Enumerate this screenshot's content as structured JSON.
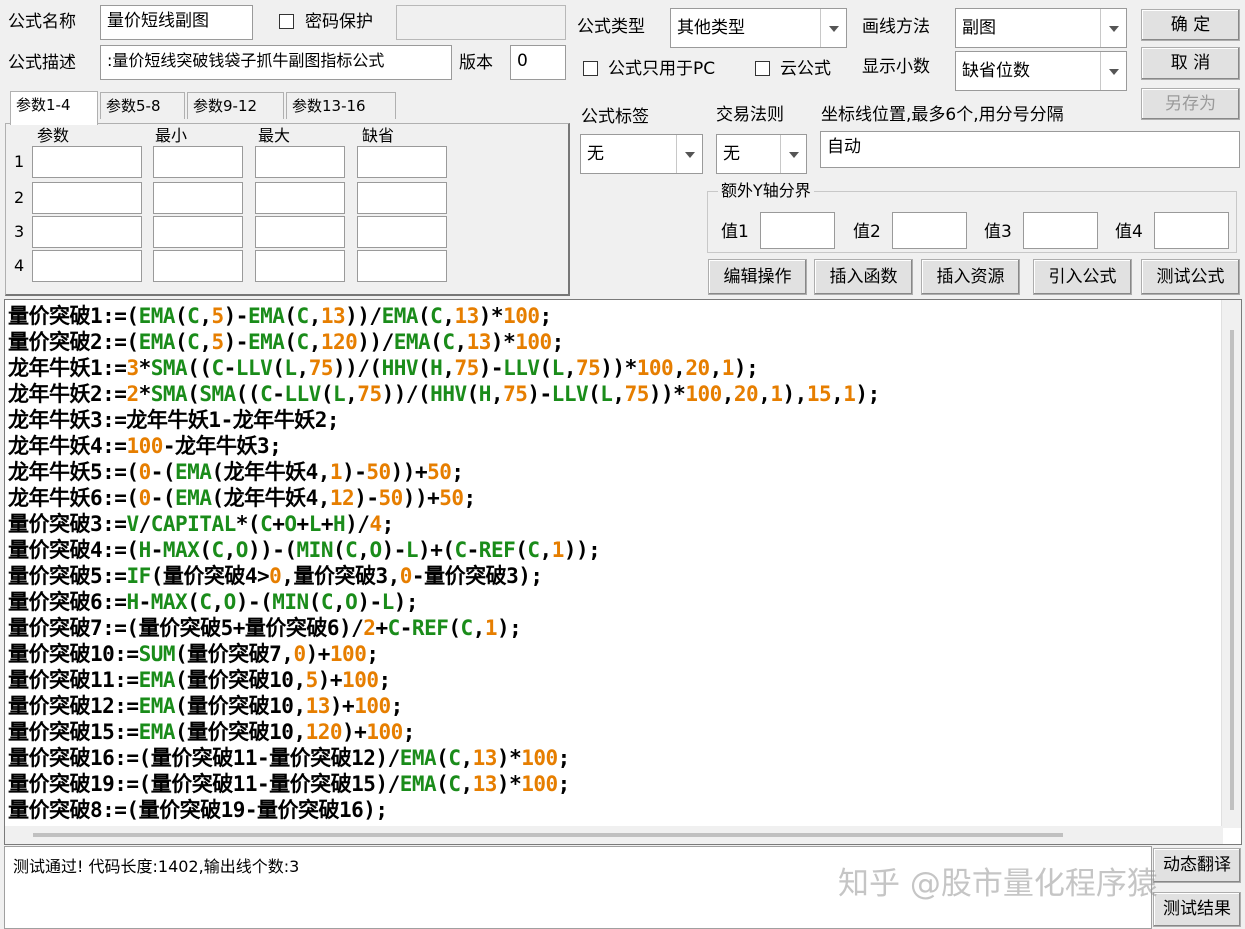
{
  "header": {
    "name_label": "公式名称",
    "name_value": "量价短线副图",
    "password_label": "密码保护",
    "desc_label": "公式描述",
    "desc_value": "量价短线突破钱袋子抓牛副图指标公式:",
    "version_label": "版本",
    "version_value": "0",
    "type_label": "公式类型",
    "type_value": "其他类型",
    "draw_label": "画线方法",
    "draw_value": "副图",
    "pc_only_label": "公式只用于PC",
    "cloud_label": "云公式",
    "decimals_label": "显示小数",
    "decimals_value": "缺省位数",
    "tag_label": "公式标签",
    "tag_value": "无",
    "rule_label": "交易法则",
    "rule_value": "无",
    "coord_label": "坐标线位置,最多6个,用分号分隔",
    "coord_value": "自动",
    "extra_y_label": "额外Y轴分界",
    "val1_label": "值1",
    "val2_label": "值2",
    "val3_label": "值3",
    "val4_label": "值4"
  },
  "buttons": {
    "ok": "确  定",
    "cancel": "取  消",
    "save_as": "另存为",
    "edit_ops": "编辑操作",
    "insert_func": "插入函数",
    "insert_res": "插入资源",
    "import_formula": "引入公式",
    "test_formula": "测试公式",
    "translate": "动态翻译",
    "test_result": "测试结果"
  },
  "params": {
    "tabs": [
      "参数1-4",
      "参数5-8",
      "参数9-12",
      "参数13-16"
    ],
    "columns": [
      "参数",
      "最小",
      "最大",
      "缺省"
    ],
    "rows": [
      "1",
      "2",
      "3",
      "4"
    ]
  },
  "code": {
    "lines": [
      [
        [
          "量价突破1:=(",
          "t"
        ],
        [
          "EMA",
          "f"
        ],
        [
          "(",
          "t"
        ],
        [
          "C",
          "f"
        ],
        [
          ",",
          "t"
        ],
        [
          "5",
          "n"
        ],
        [
          ")-",
          "t"
        ],
        [
          "EMA",
          "f"
        ],
        [
          "(",
          "t"
        ],
        [
          "C",
          "f"
        ],
        [
          ",",
          "t"
        ],
        [
          "13",
          "n"
        ],
        [
          "))/",
          "t"
        ],
        [
          "EMA",
          "f"
        ],
        [
          "(",
          "t"
        ],
        [
          "C",
          "f"
        ],
        [
          ",",
          "t"
        ],
        [
          "13",
          "n"
        ],
        [
          ")*",
          "t"
        ],
        [
          "100",
          "n"
        ],
        [
          ";",
          "t"
        ]
      ],
      [
        [
          "量价突破2:=(",
          "t"
        ],
        [
          "EMA",
          "f"
        ],
        [
          "(",
          "t"
        ],
        [
          "C",
          "f"
        ],
        [
          ",",
          "t"
        ],
        [
          "5",
          "n"
        ],
        [
          ")-",
          "t"
        ],
        [
          "EMA",
          "f"
        ],
        [
          "(",
          "t"
        ],
        [
          "C",
          "f"
        ],
        [
          ",",
          "t"
        ],
        [
          "120",
          "n"
        ],
        [
          "))/",
          "t"
        ],
        [
          "EMA",
          "f"
        ],
        [
          "(",
          "t"
        ],
        [
          "C",
          "f"
        ],
        [
          ",",
          "t"
        ],
        [
          "13",
          "n"
        ],
        [
          ")*",
          "t"
        ],
        [
          "100",
          "n"
        ],
        [
          ";",
          "t"
        ]
      ],
      [
        [
          "龙年牛妖1:=",
          "t"
        ],
        [
          "3",
          "n"
        ],
        [
          "*",
          "t"
        ],
        [
          "SMA",
          "f"
        ],
        [
          "((",
          "t"
        ],
        [
          "C",
          "f"
        ],
        [
          "-",
          "t"
        ],
        [
          "LLV",
          "f"
        ],
        [
          "(",
          "t"
        ],
        [
          "L",
          "f"
        ],
        [
          ",",
          "t"
        ],
        [
          "75",
          "n"
        ],
        [
          "))/(",
          "t"
        ],
        [
          "HHV",
          "f"
        ],
        [
          "(",
          "t"
        ],
        [
          "H",
          "f"
        ],
        [
          ",",
          "t"
        ],
        [
          "75",
          "n"
        ],
        [
          ")-",
          "t"
        ],
        [
          "LLV",
          "f"
        ],
        [
          "(",
          "t"
        ],
        [
          "L",
          "f"
        ],
        [
          ",",
          "t"
        ],
        [
          "75",
          "n"
        ],
        [
          "))*",
          "t"
        ],
        [
          "100",
          "n"
        ],
        [
          ",",
          "t"
        ],
        [
          "20",
          "n"
        ],
        [
          ",",
          "t"
        ],
        [
          "1",
          "n"
        ],
        [
          ");",
          "t"
        ]
      ],
      [
        [
          "龙年牛妖2:=",
          "t"
        ],
        [
          "2",
          "n"
        ],
        [
          "*",
          "t"
        ],
        [
          "SMA",
          "f"
        ],
        [
          "(",
          "t"
        ],
        [
          "SMA",
          "f"
        ],
        [
          "((",
          "t"
        ],
        [
          "C",
          "f"
        ],
        [
          "-",
          "t"
        ],
        [
          "LLV",
          "f"
        ],
        [
          "(",
          "t"
        ],
        [
          "L",
          "f"
        ],
        [
          ",",
          "t"
        ],
        [
          "75",
          "n"
        ],
        [
          "))/(",
          "t"
        ],
        [
          "HHV",
          "f"
        ],
        [
          "(",
          "t"
        ],
        [
          "H",
          "f"
        ],
        [
          ",",
          "t"
        ],
        [
          "75",
          "n"
        ],
        [
          ")-",
          "t"
        ],
        [
          "LLV",
          "f"
        ],
        [
          "(",
          "t"
        ],
        [
          "L",
          "f"
        ],
        [
          ",",
          "t"
        ],
        [
          "75",
          "n"
        ],
        [
          "))*",
          "t"
        ],
        [
          "100",
          "n"
        ],
        [
          ",",
          "t"
        ],
        [
          "20",
          "n"
        ],
        [
          ",",
          "t"
        ],
        [
          "1",
          "n"
        ],
        [
          "),",
          "t"
        ],
        [
          "15",
          "n"
        ],
        [
          ",",
          "t"
        ],
        [
          "1",
          "n"
        ],
        [
          ");",
          "t"
        ]
      ],
      [
        [
          "龙年牛妖3:=龙年牛妖1-龙年牛妖2;",
          "t"
        ]
      ],
      [
        [
          "龙年牛妖4:=",
          "t"
        ],
        [
          "100",
          "n"
        ],
        [
          "-龙年牛妖3;",
          "t"
        ]
      ],
      [
        [
          "龙年牛妖5:=(",
          "t"
        ],
        [
          "0",
          "n"
        ],
        [
          "-(",
          "t"
        ],
        [
          "EMA",
          "f"
        ],
        [
          "(龙年牛妖4,",
          "t"
        ],
        [
          "1",
          "n"
        ],
        [
          ")-",
          "t"
        ],
        [
          "50",
          "n"
        ],
        [
          "))+",
          "t"
        ],
        [
          "50",
          "n"
        ],
        [
          ";",
          "t"
        ]
      ],
      [
        [
          "龙年牛妖6:=(",
          "t"
        ],
        [
          "0",
          "n"
        ],
        [
          "-(",
          "t"
        ],
        [
          "EMA",
          "f"
        ],
        [
          "(龙年牛妖4,",
          "t"
        ],
        [
          "12",
          "n"
        ],
        [
          ")-",
          "t"
        ],
        [
          "50",
          "n"
        ],
        [
          "))+",
          "t"
        ],
        [
          "50",
          "n"
        ],
        [
          ";",
          "t"
        ]
      ],
      [
        [
          "量价突破3:=",
          "t"
        ],
        [
          "V",
          "f"
        ],
        [
          "/",
          "t"
        ],
        [
          "CAPITAL",
          "f"
        ],
        [
          "*(",
          "t"
        ],
        [
          "C",
          "f"
        ],
        [
          "+",
          "t"
        ],
        [
          "O",
          "f"
        ],
        [
          "+",
          "t"
        ],
        [
          "L",
          "f"
        ],
        [
          "+",
          "t"
        ],
        [
          "H",
          "f"
        ],
        [
          ")/",
          "t"
        ],
        [
          "4",
          "n"
        ],
        [
          ";",
          "t"
        ]
      ],
      [
        [
          "量价突破4:=(",
          "t"
        ],
        [
          "H",
          "f"
        ],
        [
          "-",
          "t"
        ],
        [
          "MAX",
          "f"
        ],
        [
          "(",
          "t"
        ],
        [
          "C",
          "f"
        ],
        [
          ",",
          "t"
        ],
        [
          "O",
          "f"
        ],
        [
          "))-(",
          "t"
        ],
        [
          "MIN",
          "f"
        ],
        [
          "(",
          "t"
        ],
        [
          "C",
          "f"
        ],
        [
          ",",
          "t"
        ],
        [
          "O",
          "f"
        ],
        [
          ")-",
          "t"
        ],
        [
          "L",
          "f"
        ],
        [
          ")+(",
          "t"
        ],
        [
          "C",
          "f"
        ],
        [
          "-",
          "t"
        ],
        [
          "REF",
          "f"
        ],
        [
          "(",
          "t"
        ],
        [
          "C",
          "f"
        ],
        [
          ",",
          "t"
        ],
        [
          "1",
          "n"
        ],
        [
          "));",
          "t"
        ]
      ],
      [
        [
          "量价突破5:=",
          "t"
        ],
        [
          "IF",
          "f"
        ],
        [
          "(量价突破4>",
          "t"
        ],
        [
          "0",
          "n"
        ],
        [
          ",量价突破3,",
          "t"
        ],
        [
          "0",
          "n"
        ],
        [
          "-量价突破3);",
          "t"
        ]
      ],
      [
        [
          "量价突破6:=",
          "t"
        ],
        [
          "H",
          "f"
        ],
        [
          "-",
          "t"
        ],
        [
          "MAX",
          "f"
        ],
        [
          "(",
          "t"
        ],
        [
          "C",
          "f"
        ],
        [
          ",",
          "t"
        ],
        [
          "O",
          "f"
        ],
        [
          ")-(",
          "t"
        ],
        [
          "MIN",
          "f"
        ],
        [
          "(",
          "t"
        ],
        [
          "C",
          "f"
        ],
        [
          ",",
          "t"
        ],
        [
          "O",
          "f"
        ],
        [
          ")-",
          "t"
        ],
        [
          "L",
          "f"
        ],
        [
          ");",
          "t"
        ]
      ],
      [
        [
          "量价突破7:=(量价突破5+量价突破6)/",
          "t"
        ],
        [
          "2",
          "n"
        ],
        [
          "+",
          "t"
        ],
        [
          "C",
          "f"
        ],
        [
          "-",
          "t"
        ],
        [
          "REF",
          "f"
        ],
        [
          "(",
          "t"
        ],
        [
          "C",
          "f"
        ],
        [
          ",",
          "t"
        ],
        [
          "1",
          "n"
        ],
        [
          ");",
          "t"
        ]
      ],
      [
        [
          "量价突破10:=",
          "t"
        ],
        [
          "SUM",
          "f"
        ],
        [
          "(量价突破7,",
          "t"
        ],
        [
          "0",
          "n"
        ],
        [
          ")+",
          "t"
        ],
        [
          "100",
          "n"
        ],
        [
          ";",
          "t"
        ]
      ],
      [
        [
          "量价突破11:=",
          "t"
        ],
        [
          "EMA",
          "f"
        ],
        [
          "(量价突破10,",
          "t"
        ],
        [
          "5",
          "n"
        ],
        [
          ")+",
          "t"
        ],
        [
          "100",
          "n"
        ],
        [
          ";",
          "t"
        ]
      ],
      [
        [
          "量价突破12:=",
          "t"
        ],
        [
          "EMA",
          "f"
        ],
        [
          "(量价突破10,",
          "t"
        ],
        [
          "13",
          "n"
        ],
        [
          ")+",
          "t"
        ],
        [
          "100",
          "n"
        ],
        [
          ";",
          "t"
        ]
      ],
      [
        [
          "量价突破15:=",
          "t"
        ],
        [
          "EMA",
          "f"
        ],
        [
          "(量价突破10,",
          "t"
        ],
        [
          "120",
          "n"
        ],
        [
          ")+",
          "t"
        ],
        [
          "100",
          "n"
        ],
        [
          ";",
          "t"
        ]
      ],
      [
        [
          "量价突破16:=(量价突破11-量价突破12)/",
          "t"
        ],
        [
          "EMA",
          "f"
        ],
        [
          "(",
          "t"
        ],
        [
          "C",
          "f"
        ],
        [
          ",",
          "t"
        ],
        [
          "13",
          "n"
        ],
        [
          ")*",
          "t"
        ],
        [
          "100",
          "n"
        ],
        [
          ";",
          "t"
        ]
      ],
      [
        [
          "量价突破19:=(量价突破11-量价突破15)/",
          "t"
        ],
        [
          "EMA",
          "f"
        ],
        [
          "(",
          "t"
        ],
        [
          "C",
          "f"
        ],
        [
          ",",
          "t"
        ],
        [
          "13",
          "n"
        ],
        [
          ")*",
          "t"
        ],
        [
          "100",
          "n"
        ],
        [
          ";",
          "t"
        ]
      ],
      [
        [
          "量价突破8:=(量价突破19-量价突破16);",
          "t"
        ]
      ]
    ]
  },
  "status": {
    "message": "测试通过! 代码长度:1402,输出线个数:3"
  },
  "watermark": "知乎 @股市量化程序猿"
}
